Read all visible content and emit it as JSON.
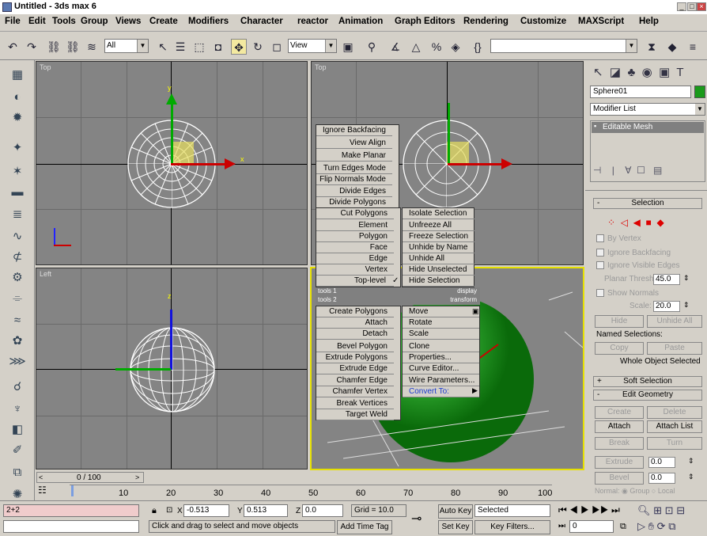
{
  "window": {
    "title": "Untitled - 3ds max 6"
  },
  "menu": [
    "File",
    "Edit",
    "Tools",
    "Group",
    "Views",
    "Create",
    "Modifiers",
    "Character",
    "reactor",
    "Animation",
    "Graph Editors",
    "Rendering",
    "Customize",
    "MAXScript",
    "Help"
  ],
  "toolbar": {
    "selection_filter": "All",
    "ref_coord": "View"
  },
  "viewports": {
    "top_left": "Top",
    "top_right": "Top",
    "bottom_left": "Left"
  },
  "axis": {
    "x": "x",
    "y": "y",
    "z": "z"
  },
  "quad_left": [
    "Ignore Backfacing",
    "View Align",
    "Make Planar",
    "Turn Edges Mode",
    "Flip Normals Mode",
    "Divide Edges",
    "Divide Polygons",
    "Cut Polygons",
    "Element",
    "Polygon",
    "Face",
    "Edge",
    "Vertex",
    "Top-level"
  ],
  "quad_right_top": [
    "Isolate Selection",
    "Unfreeze All",
    "Freeze Selection",
    "Unhide by Name",
    "Unhide All",
    "Hide Unselected",
    "Hide Selection"
  ],
  "quad_headers": {
    "tools1": "tools 1",
    "display": "display",
    "tools2": "tools 2",
    "transform": "transform"
  },
  "quad_left_bottom": [
    "Create Polygons",
    "Attach",
    "Detach",
    "Bevel Polygon",
    "Extrude Polygons",
    "Extrude Edge",
    "Chamfer Edge",
    "Chamfer Vertex",
    "Break Vertices",
    "Target Weld"
  ],
  "quad_right_bottom": [
    "Move",
    "Rotate",
    "Scale",
    "Clone",
    "Properties...",
    "Curve Editor...",
    "Wire Parameters...",
    "Convert To:"
  ],
  "cmd": {
    "object_name": "Sphere01",
    "modifier_list": "Modifier List",
    "stack_item": "Editable Mesh",
    "selection_hdr": "Selection",
    "by_vertex": "By Vertex",
    "ignore_backfacing": "Ignore Backfacing",
    "ignore_visible": "Ignore Visible Edges",
    "planar_thresh": "Planar Thresh:",
    "planar_val": "45.0",
    "show_normals": "Show Normals",
    "scale": "Scale:",
    "scale_val": "20.0",
    "hide": "Hide",
    "unhide_all": "Unhide All",
    "named_sel": "Named Selections:",
    "copy": "Copy",
    "paste": "Paste",
    "whole": "Whole Object Selected",
    "soft_sel": "Soft Selection",
    "edit_geo": "Edit Geometry",
    "create": "Create",
    "delete": "Delete",
    "attach": "Attach",
    "attach_list": "Attach List",
    "break": "Break",
    "turn": "Turn",
    "extrude": "Extrude",
    "extrude_val": "0.0",
    "bevel": "Bevel",
    "bevel_val": "0.0",
    "normal": "Normal:",
    "group": "Group",
    "local": "Local"
  },
  "time": {
    "slider": "0 / 100",
    "ticks": [
      "10",
      "20",
      "30",
      "40",
      "50",
      "60",
      "70",
      "80",
      "90",
      "100"
    ]
  },
  "status": {
    "script_top": "2+2",
    "x_val": "-0.513",
    "y_val": "0.513",
    "z_val": "0.0",
    "grid": "Grid = 10.0",
    "auto_key": "Auto Key",
    "selected": "Selected",
    "set_key": "Set Key",
    "key_filters": "Key Filters...",
    "prompt": "Click and drag to select and move objects",
    "add_tag": "Add Time Tag",
    "frame": "0",
    "x": "X",
    "y": "Y",
    "z": "Z"
  }
}
